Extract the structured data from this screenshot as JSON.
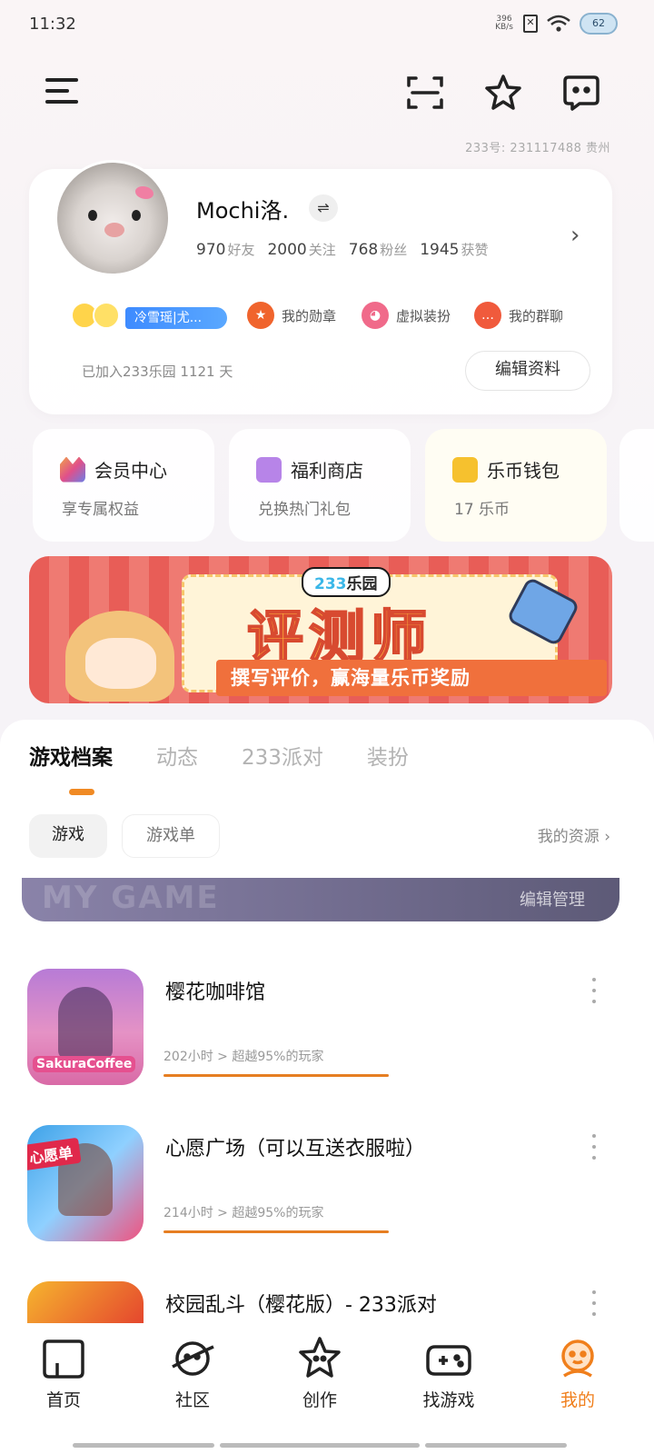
{
  "status_bar": {
    "time": "11:32",
    "net_speed_value": "396",
    "net_speed_unit": "KB/s",
    "sim_label": "✕",
    "battery": "62"
  },
  "header": {
    "account_line": "233号: 231117488   贵州"
  },
  "profile": {
    "username": "Mochi洛.",
    "switch_glyph": "⇌",
    "stats": [
      {
        "value": "970",
        "label": "好友"
      },
      {
        "value": "2000",
        "label": "关注"
      },
      {
        "value": "768",
        "label": "粉丝"
      },
      {
        "value": "1945",
        "label": "获赞"
      }
    ],
    "title_badge": "冷雪瑶|尤...",
    "quick_links": {
      "medals": "我的勋章",
      "dressup": "虚拟装扮",
      "groups": "我的群聊"
    },
    "joined": "已加入233乐园 1121 天",
    "edit_button": "编辑资料"
  },
  "services": [
    {
      "title": "会员中心",
      "subtitle": "享专属权益",
      "icon": "crown-icon",
      "color": "#f08a5d"
    },
    {
      "title": "福利商店",
      "subtitle": "兑换热门礼包",
      "icon": "gift-icon",
      "color": "#b784e8"
    },
    {
      "title": "乐币钱包",
      "subtitle": "17 乐币",
      "icon": "wallet-icon",
      "color": "#f6c12e"
    }
  ],
  "banner": {
    "brand_nums": "233",
    "brand_text": "乐园",
    "title": "评测师",
    "subtitle": "撰写评价，赢海量乐币奖励"
  },
  "tabs": [
    "游戏档案",
    "动态",
    "233派对",
    "装扮"
  ],
  "chips": {
    "games": "游戏",
    "game_lists": "游戏单",
    "my_resources": "我的资源 ›"
  },
  "mygame": {
    "watermark": "MY GAME",
    "edit": "编辑管理"
  },
  "games": [
    {
      "name": "樱花咖啡馆",
      "playtime": "202小时 > 超越95%的玩家",
      "icon_label": "SakuraCoffee"
    },
    {
      "name": "心愿广场（可以互送衣服啦）",
      "playtime": "214小时 > 超越95%的玩家",
      "icon_label": "心愿单"
    },
    {
      "name": "校园乱斗（樱花版）- 233派对",
      "playtime": "",
      "icon_label": ""
    }
  ],
  "bottom_nav": [
    {
      "label": "首页",
      "icon": "home-icon"
    },
    {
      "label": "社区",
      "icon": "planet-icon"
    },
    {
      "label": "创作",
      "icon": "create-star-icon"
    },
    {
      "label": "找游戏",
      "icon": "gamepad-icon"
    },
    {
      "label": "我的",
      "icon": "profile-face-icon"
    }
  ],
  "accent_color": "#f08a24"
}
